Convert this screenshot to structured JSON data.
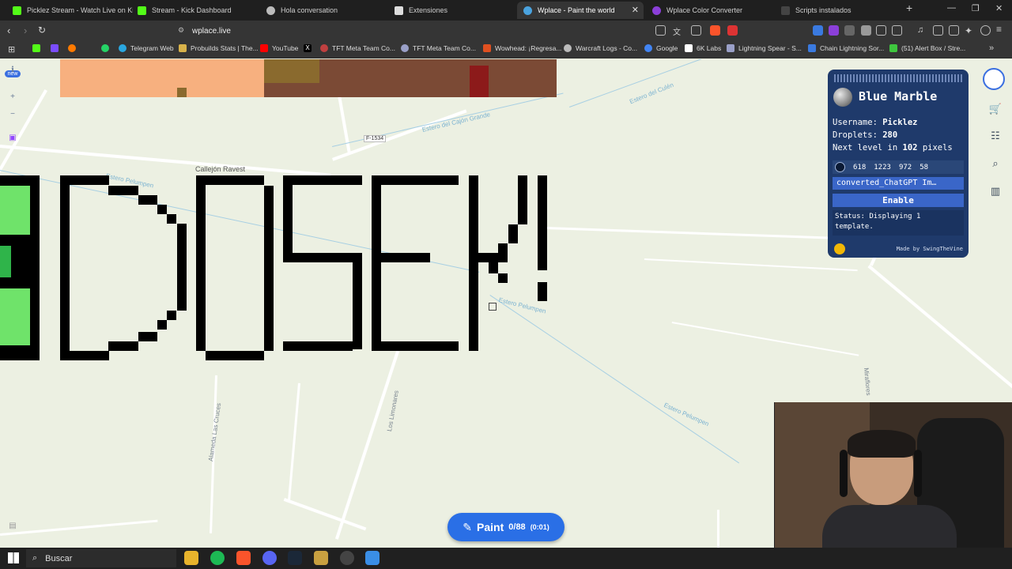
{
  "tabs": [
    {
      "label": "Picklez Stream - Watch Live on Kick",
      "color": "#53fc18"
    },
    {
      "label": "Stream - Kick Dashboard",
      "color": "#53fc18"
    },
    {
      "label": "Hola conversation",
      "color": "#bbbbbb"
    },
    {
      "label": "Extensiones",
      "color": "#dddddd"
    },
    {
      "label": "Wplace - Paint the world",
      "color": "#4aa3df"
    },
    {
      "label": "Wplace Color Converter",
      "color": "#8b3fd9"
    },
    {
      "label": "Scripts instalados",
      "color": "#444444"
    }
  ],
  "address": {
    "url": "wplace.live"
  },
  "bookmarks": [
    {
      "label": "",
      "color": "#53fc18"
    },
    {
      "label": "",
      "color": "#7b4dff"
    },
    {
      "label": "",
      "color": "#ff7a00"
    },
    {
      "label": "",
      "color": "#25d366"
    },
    {
      "label": "Telegram Web",
      "color": "#2aa7e0"
    },
    {
      "label": "Probuilds Stats | The...",
      "color": "#d8b24a"
    },
    {
      "label": "YouTube",
      "color": "#ff0000"
    },
    {
      "label": "",
      "color": "#dddddd"
    },
    {
      "label": "TFT Meta Team Co...",
      "color": "#c04040"
    },
    {
      "label": "TFT Meta Team Co...",
      "color": "#9aa0c8"
    },
    {
      "label": "Wowhead: ¡Regresa...",
      "color": "#e05020"
    },
    {
      "label": "Warcraft Logs - Co...",
      "color": "#bbbbbb"
    },
    {
      "label": "Google",
      "color": "#4285f4"
    },
    {
      "label": "6K Labs",
      "color": "#ffffff"
    },
    {
      "label": "Lightning Spear - S...",
      "color": "#9aa0c8"
    },
    {
      "label": "Chain Lightning Sor...",
      "color": "#3a7ae0"
    },
    {
      "label": "(51) Alert Box / Stre...",
      "color": "#3ec63e"
    }
  ],
  "map_labels": {
    "road1": "F-1534",
    "road2": "Callejón Ravest",
    "road3": "Alameda Las Cruces",
    "road4": "Los Limonares",
    "road5": "Miraflores",
    "water1": "Estero del Culén",
    "water2": "Estero del Cajón Grande",
    "water3": "Estero Pelumpen",
    "water4": "Estero Pelumpen",
    "water5": "Estero Pelumpen"
  },
  "blue_marble": {
    "title": "Blue Marble",
    "username_label": "Username:",
    "username": "Picklez",
    "droplets_label": "Droplets:",
    "droplets": "280",
    "next_level_prefix": "Next level in",
    "next_level_pixels": "102",
    "next_level_suffix": "pixels",
    "coords": [
      "618",
      "1223",
      "972",
      "58"
    ],
    "template_file": "converted_ChatGPT Im…",
    "enable_label": "Enable",
    "status": "Status: Displaying 1 template.",
    "made_by": "Made by SwingTheVine"
  },
  "left_controls": {
    "badge": "new"
  },
  "paint": {
    "label": "Paint",
    "count": "0/88",
    "timer": "(0:01)"
  },
  "taskbar": {
    "search_placeholder": "Buscar"
  }
}
